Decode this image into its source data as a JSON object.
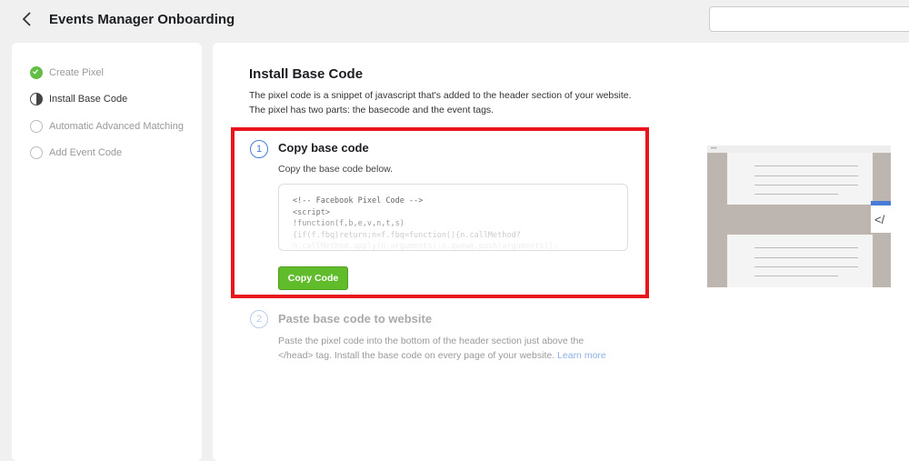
{
  "header": {
    "title": "Events Manager Onboarding",
    "search_placeholder": ""
  },
  "sidebar": {
    "steps": [
      {
        "label": "Create Pixel",
        "state": "done"
      },
      {
        "label": "Install Base Code",
        "state": "active"
      },
      {
        "label": "Automatic Advanced Matching",
        "state": "pending"
      },
      {
        "label": "Add Event Code",
        "state": "pending"
      }
    ]
  },
  "main": {
    "title": "Install Base Code",
    "desc_1": "The pixel code is a snippet of javascript that's added to the header section of your website.",
    "desc_2": "The pixel has two parts: the basecode and the event tags.",
    "step1": {
      "number": "1",
      "title": "Copy base code",
      "subtitle": "Copy the base code below.",
      "code_lines": [
        "<!-- Facebook Pixel Code -->",
        "<script>",
        "!function(f,b,e,v,n,t,s)",
        "{if(f.fbq)return;n=f.fbq=function(){n.callMethod?",
        "n.callMethod.apply(n,arguments):n.queue.push(arguments)};"
      ],
      "button": "Copy Code"
    },
    "step2": {
      "number": "2",
      "title": "Paste base code to website",
      "text_1": "Paste the pixel code into the bottom of the header section just above the",
      "text_2": "</head> tag. Install the base code on every page of your website.",
      "link": "Learn more"
    },
    "illustration_tag": "</"
  },
  "colors": {
    "accent": "#4a7bd6",
    "button": "#61bc2c",
    "highlight": "#e8151c",
    "done": "#63be45"
  }
}
